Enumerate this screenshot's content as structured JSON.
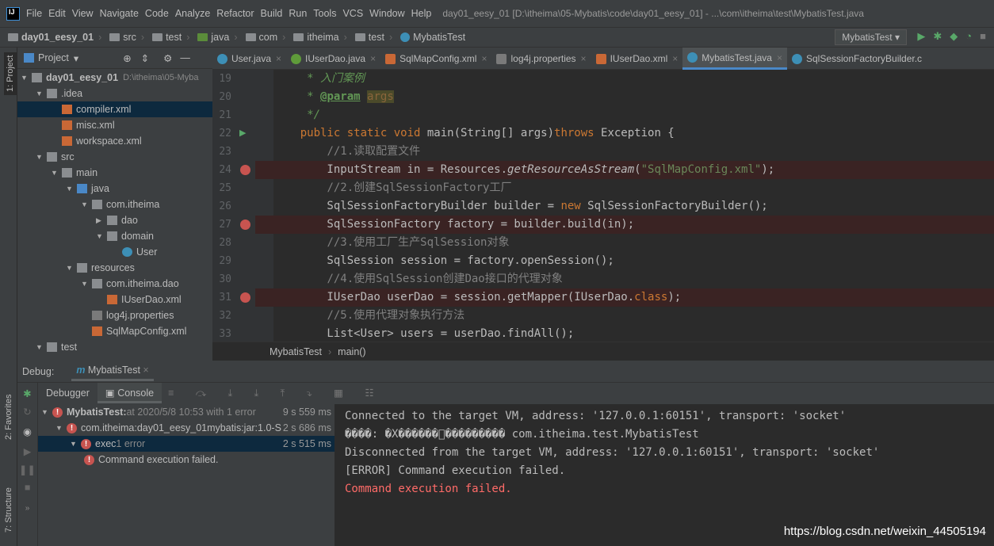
{
  "menu": {
    "logo": "IJ",
    "items": [
      "File",
      "Edit",
      "View",
      "Navigate",
      "Code",
      "Analyze",
      "Refactor",
      "Build",
      "Run",
      "Tools",
      "VCS",
      "Window",
      "Help"
    ],
    "title": "day01_eesy_01 [D:\\itheima\\05-Mybatis\\code\\day01_eesy_01] - ...\\com\\itheima\\test\\MybatisTest.java"
  },
  "nav": {
    "crumbs": [
      "day01_eesy_01",
      "src",
      "test",
      "java",
      "com",
      "itheima",
      "test",
      "MybatisTest"
    ],
    "run_config": "MybatisTest"
  },
  "strip": {
    "project": "1: Project",
    "favorites": "2: Favorites",
    "structure": "7: Structure"
  },
  "project": {
    "title": "Project",
    "tree": [
      {
        "label": "day01_eesy_01",
        "extra": "D:\\itheima\\05-Myba",
        "level": 0,
        "icon": "folder",
        "open": true
      },
      {
        "label": ".idea",
        "level": 1,
        "icon": "folder",
        "open": true
      },
      {
        "label": "compiler.xml",
        "level": 2,
        "icon": "xml",
        "selected": true
      },
      {
        "label": "misc.xml",
        "level": 2,
        "icon": "xml"
      },
      {
        "label": "workspace.xml",
        "level": 2,
        "icon": "xml"
      },
      {
        "label": "src",
        "level": 1,
        "icon": "folder",
        "open": true
      },
      {
        "label": "main",
        "level": 2,
        "icon": "folder",
        "open": true
      },
      {
        "label": "java",
        "level": 3,
        "icon": "folder-blue",
        "open": true
      },
      {
        "label": "com.itheima",
        "level": 4,
        "icon": "package",
        "open": true
      },
      {
        "label": "dao",
        "level": 5,
        "icon": "package",
        "open": false
      },
      {
        "label": "domain",
        "level": 5,
        "icon": "package",
        "open": true
      },
      {
        "label": "User",
        "level": 6,
        "icon": "class"
      },
      {
        "label": "resources",
        "level": 3,
        "icon": "folder",
        "open": true
      },
      {
        "label": "com.itheima.dao",
        "level": 4,
        "icon": "folder",
        "open": true
      },
      {
        "label": "IUserDao.xml",
        "level": 5,
        "icon": "xml"
      },
      {
        "label": "log4j.properties",
        "level": 4,
        "icon": "properties"
      },
      {
        "label": "SqlMapConfig.xml",
        "level": 4,
        "icon": "xml"
      },
      {
        "label": "test",
        "level": 1,
        "icon": "folder",
        "open": true
      }
    ]
  },
  "tabs": [
    {
      "label": "User.java",
      "icon": "class",
      "color": "#3d8fb6"
    },
    {
      "label": "IUserDao.java",
      "icon": "interface",
      "color": "#5f9b3a"
    },
    {
      "label": "SqlMapConfig.xml",
      "icon": "xml",
      "color": "#c96836"
    },
    {
      "label": "log4j.properties",
      "icon": "properties",
      "color": "#7a7a7a"
    },
    {
      "label": "IUserDao.xml",
      "icon": "xml",
      "color": "#c96836"
    },
    {
      "label": "MybatisTest.java",
      "icon": "class",
      "color": "#3d8fb6",
      "active": true
    },
    {
      "label": "SqlSessionFactoryBuilder.c",
      "icon": "class",
      "color": "#3d8fb6"
    }
  ],
  "code": {
    "lines": [
      {
        "n": "19",
        "html": "     <span class=\"doc\">* 入门案例</span>"
      },
      {
        "n": "20",
        "html": "     <span class=\"doc\">* </span><span class=\"tag\">@param</span> <span class=\"par\">args</span>"
      },
      {
        "n": "21",
        "html": "     <span class=\"doc\">*/</span>"
      },
      {
        "n": "22",
        "run": true,
        "html": "    <span class=\"kw\">public static void</span> main(String[] args)<span class=\"kw\">throws</span> Exception {"
      },
      {
        "n": "23",
        "html": "        <span class=\"cm\">//1.读取配置文件</span>"
      },
      {
        "n": "24",
        "bp": true,
        "html": "        InputStream in = Resources.<span class=\"it\">getResourceAsStream</span>(<span class=\"str\">\"SqlMapConfig.xml\"</span>);"
      },
      {
        "n": "25",
        "html": "        <span class=\"cm\">//2.创建SqlSessionFactory工厂</span>"
      },
      {
        "n": "26",
        "html": "        SqlSessionFactoryBuilder builder = <span class=\"kw\">new</span> SqlSessionFactoryBuilder();"
      },
      {
        "n": "27",
        "bp": true,
        "html": "        SqlSessionFactory factory = builder.build(in);"
      },
      {
        "n": "28",
        "html": "        <span class=\"cm\">//3.使用工厂生产SqlSession对象</span>"
      },
      {
        "n": "29",
        "html": "        SqlSession session = factory.openSession();"
      },
      {
        "n": "30",
        "html": "        <span class=\"cm\">//4.使用SqlSession创建Dao接口的代理对象</span>"
      },
      {
        "n": "31",
        "bp": true,
        "html": "        IUserDao userDao = session.getMapper(IUserDao.<span class=\"kw\">class</span>);"
      },
      {
        "n": "32",
        "html": "        <span class=\"cm\">//5.使用代理对象执行方法</span>"
      },
      {
        "n": "33",
        "html": "        List&lt;User&gt; users = userDao.findAll();"
      }
    ]
  },
  "editor_breadcrumb": [
    "MybatisTest",
    "main()"
  ],
  "debug": {
    "label": "Debug:",
    "tab": "MybatisTest",
    "tabs": [
      "Debugger",
      "Console"
    ],
    "tree": [
      {
        "bold": "MybatisTest:",
        "text": " at 2020/5/8 10:53 with 1 error",
        "time": "9 s 559 ms",
        "level": 0
      },
      {
        "text": "com.itheima:day01_eesy_01mybatis:jar:1.0-S",
        "time": "2 s 686 ms",
        "level": 1
      },
      {
        "text": "exec",
        "grey": " 1 error",
        "time": "2 s 515 ms",
        "level": 2,
        "selected": true
      },
      {
        "text": "Command execution failed.",
        "level": 3
      }
    ],
    "console": [
      {
        "text": "Connected to the target VM, address: '127.0.0.1:60151', transport: 'socket'",
        "color": "#bbbbbb"
      },
      {
        "text": "����: �X������\u0000��������� com.itheima.test.MybatisTest",
        "color": "#bbbbbb"
      },
      {
        "text": "Disconnected from the target VM, address: '127.0.0.1:60151', transport: 'socket'",
        "color": "#bbbbbb"
      },
      {
        "text": "[ERROR] Command execution failed.",
        "color": "#bbbbbb"
      },
      {
        "text": "Command execution failed.",
        "color": "#ff6b68"
      }
    ]
  },
  "watermark": "https://blog.csdn.net/weixin_44505194"
}
